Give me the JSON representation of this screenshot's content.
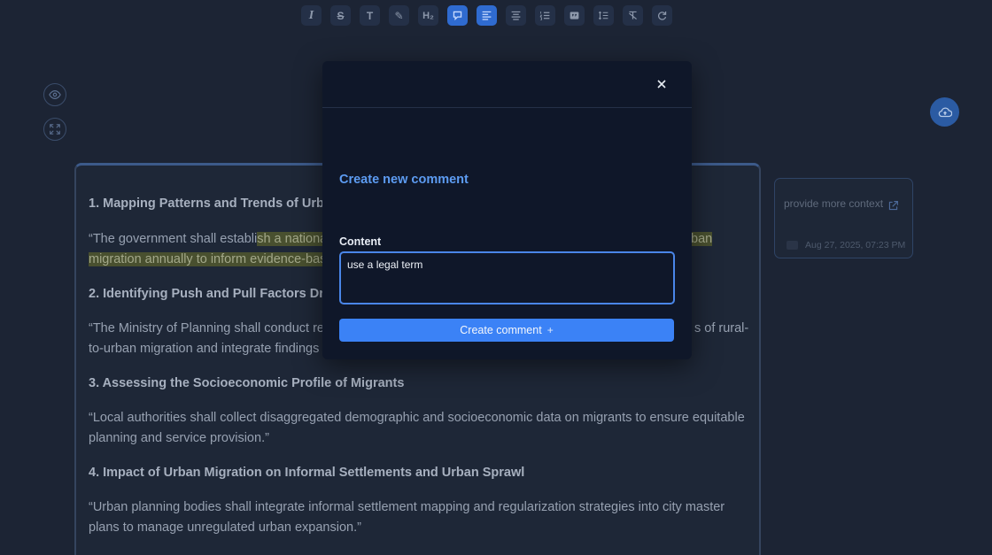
{
  "toolbar": {
    "buttons": [
      {
        "name": "italic-icon",
        "glyph": "I"
      },
      {
        "name": "strikethrough-icon",
        "glyph": "S"
      },
      {
        "name": "text-size-icon",
        "glyph": "T"
      },
      {
        "name": "highlight-pen-icon",
        "glyph": "✎"
      },
      {
        "name": "heading2-icon",
        "glyph": "H₂"
      },
      {
        "name": "comment-icon",
        "glyph": "▣",
        "active": true
      },
      {
        "name": "align-left-icon",
        "glyph": "≡",
        "active": true
      },
      {
        "name": "align-center-icon",
        "glyph": "≡"
      },
      {
        "name": "ordered-list-icon",
        "glyph": "1≡"
      },
      {
        "name": "quote-icon",
        "glyph": "❝"
      },
      {
        "name": "line-height-icon",
        "glyph": "☰"
      },
      {
        "name": "clear-format-icon",
        "glyph": "T̸"
      },
      {
        "name": "redo-icon",
        "glyph": "↻"
      }
    ]
  },
  "document": {
    "h1": "1. Mapping Patterns and Trends of Urban M",
    "p1_part1": " “The government shall establi",
    "p1_hl1": "sh a national d",
    "p1_hl_right": "ban",
    "p1_line2_hl": "migration annually to inform evidence-based",
    "h2": "2. Identifying Push and Pull Factors Driving",
    "p2_line1_left": " “The Ministry of Planning shall conduct regu",
    "p2_line1_right": "s of rural-",
    "p2_line2": "to-urban migration and integrate findings into",
    "h3": "3. Assessing the Socioeconomic Profile of Migrants",
    "p3": " “Local authorities shall collect disaggregated demographic and socioeconomic data on migrants to ensure equitable planning and service provision.”",
    "h4": "4. Impact of Urban Migration on Informal Settlements and Urban Sprawl",
    "p4": " “Urban planning bodies shall integrate informal settlement mapping and regularization strategies into city master plans to manage unregulated urban expansion.”"
  },
  "comment_card": {
    "text": "provide more context",
    "date": "Aug 27, 2025, 07:23 PM"
  },
  "modal": {
    "title": "Create new comment",
    "content_label": "Content",
    "content_value": "use a legal term",
    "submit_label": "Create comment",
    "submit_icon": "+"
  },
  "colors": {
    "accent": "#3b82f6",
    "highlight": "#49502f",
    "background": "#1c2434"
  }
}
